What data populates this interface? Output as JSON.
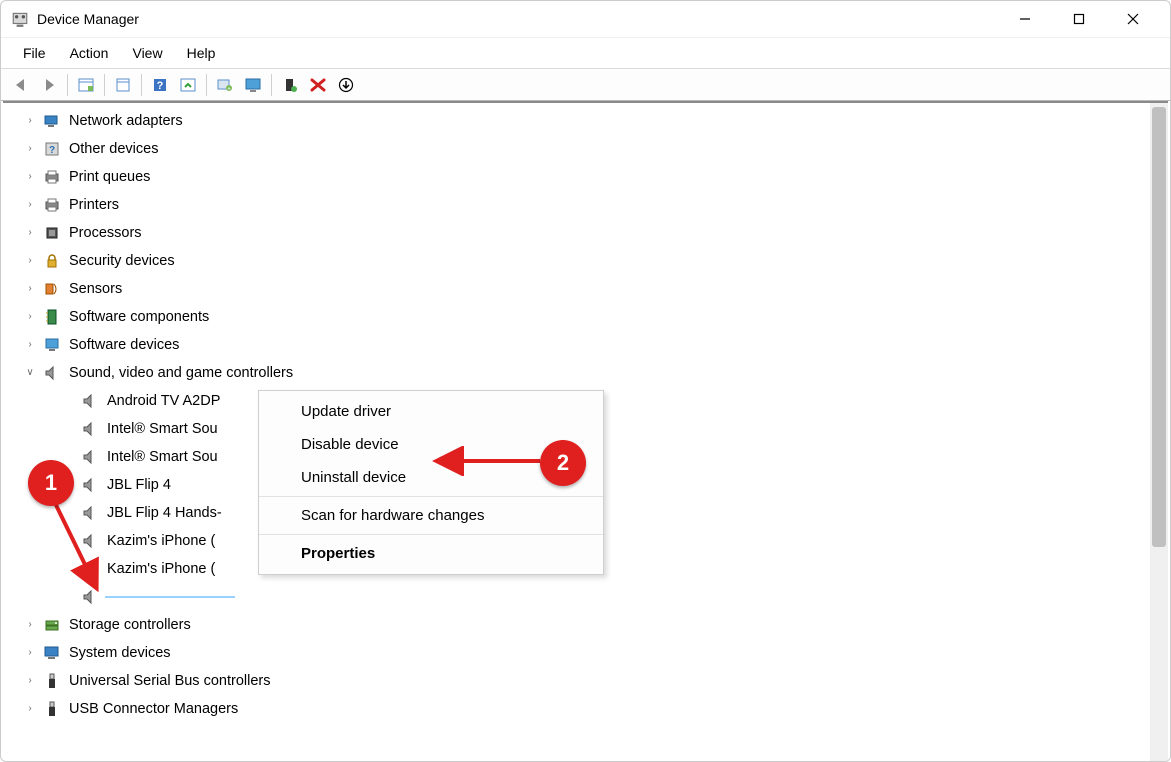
{
  "window": {
    "title": "Device Manager"
  },
  "menubar": {
    "items": [
      "File",
      "Action",
      "View",
      "Help"
    ]
  },
  "toolbar": {
    "buttons": [
      "back",
      "forward",
      "show-hidden",
      "properties",
      "help",
      "update-driver",
      "uninstall",
      "scan-hardware",
      "enable",
      "disable",
      "uninstall-x",
      "down"
    ]
  },
  "tree": {
    "nodes": [
      {
        "label": "Network adapters",
        "icon": "network-icon",
        "expandable": true
      },
      {
        "label": "Other devices",
        "icon": "unknown-device-icon",
        "expandable": true
      },
      {
        "label": "Print queues",
        "icon": "print-queue-icon",
        "expandable": true
      },
      {
        "label": "Printers",
        "icon": "printer-icon",
        "expandable": true
      },
      {
        "label": "Processors",
        "icon": "cpu-icon",
        "expandable": true
      },
      {
        "label": "Security devices",
        "icon": "security-icon",
        "expandable": true
      },
      {
        "label": "Sensors",
        "icon": "sensor-icon",
        "expandable": true
      },
      {
        "label": "Software components",
        "icon": "component-icon",
        "expandable": true
      },
      {
        "label": "Software devices",
        "icon": "software-device-icon",
        "expandable": true
      },
      {
        "label": "Sound, video and game controllers",
        "icon": "speaker-icon",
        "expanded": true
      },
      {
        "label": "Storage controllers",
        "icon": "storage-icon",
        "expandable": true
      },
      {
        "label": "System devices",
        "icon": "system-icon",
        "expandable": true
      },
      {
        "label": "Universal Serial Bus controllers",
        "icon": "usb-icon",
        "expandable": true
      },
      {
        "label": "USB Connector Managers",
        "icon": "usb-connector-icon",
        "expandable": true
      }
    ],
    "sound_children": [
      {
        "label": "Android TV A2DP"
      },
      {
        "label": "Intel® Smart Sou"
      },
      {
        "label": "Intel® Smart Sou"
      },
      {
        "label": "JBL Flip 4"
      },
      {
        "label": "JBL Flip 4 Hands-"
      },
      {
        "label": "Kazim's iPhone ("
      },
      {
        "label": "Kazim's iPhone ("
      },
      {
        "label": "",
        "selected": true
      }
    ]
  },
  "context_menu": {
    "items": [
      {
        "label": "Update driver"
      },
      {
        "label": "Disable device"
      },
      {
        "label": "Uninstall device"
      },
      {
        "separator": true
      },
      {
        "label": "Scan for hardware changes"
      },
      {
        "separator": true
      },
      {
        "label": "Properties",
        "bold": true
      }
    ]
  },
  "annotations": {
    "badges": [
      "1",
      "2"
    ]
  }
}
